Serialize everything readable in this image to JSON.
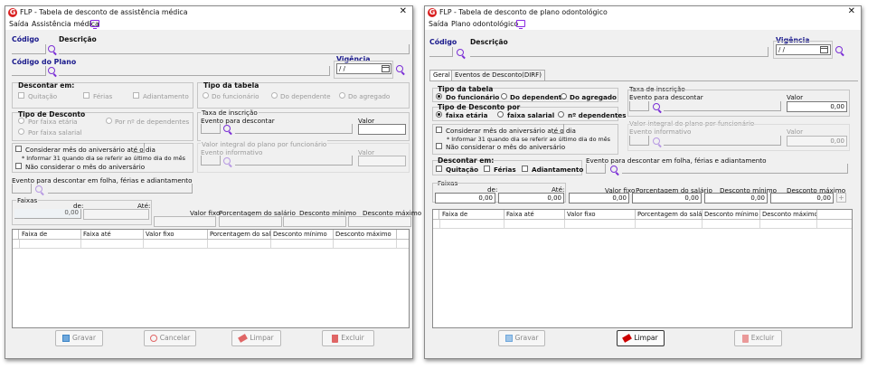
{
  "left": {
    "title": "FLP - Tabela de desconto de assistência médica",
    "close": "✕",
    "menu": {
      "saida": "Saída",
      "item": "Assistência médica"
    },
    "codigo": "Código",
    "descricao": "Descrição",
    "codigo_plano": "Código do Plano",
    "vigencia": "Vigência",
    "vigencia_value": "/ /",
    "descontar_em": "Descontar em:",
    "desc_quitacao": "Quitação",
    "desc_ferias": "Férias",
    "desc_adiantamento": "Adiantamento",
    "tipo_tabela": "Tipo da tabela",
    "tt_funcionario": "Do funcionário",
    "tt_dependente": "Do dependente",
    "tt_agregado": "Do agregado",
    "tipo_desconto": "Tipo de Desconto",
    "td_faixa_etaria": "Por faixa etária",
    "td_n_dependentes": "Por nº de dependentes",
    "td_faixa_salarial": "Por faixa salarial",
    "taxa_inscricao": "Taxa de inscrição",
    "evento_para_descontar": "Evento para descontar",
    "valor": "Valor",
    "considerar_mes": "Considerar mês do aniversário até o dia",
    "informar_31": "* Informar 31 quando dia se referir ao último dia do mês",
    "nao_considerar": "Não considerar o mês do aniversário",
    "valor_integral": "Valor integral do plano por funcionário",
    "evento_informativo": "Evento informativo",
    "evento_folha": "Evento para descontar em folha, férias e adiantamento",
    "faixas": "Faixas",
    "de": "de:",
    "ate": "Até:",
    "de_value": "0,00",
    "valor_fixo": "Valor fixo",
    "porc_salario": "Porcentagem do salário",
    "desc_minimo": "Desconto mínimo",
    "desc_maximo": "Desconto máximo",
    "grid_cols": [
      "Faixa de",
      "Faixa até",
      "Valor fixo",
      "Porcentagem do salário",
      "Desconto mínimo",
      "Desconto máximo"
    ],
    "buttons": {
      "gravar": "Gravar",
      "cancelar": "Cancelar",
      "limpar": "Limpar",
      "excluir": "Excluir"
    }
  },
  "right": {
    "title": "FLP - Tabela de desconto de plano odontológico",
    "close": "✕",
    "menu": {
      "saida": "Saída",
      "item": "Plano odontológico"
    },
    "codigo": "Código",
    "descricao": "Descrição",
    "vigencia": "Vigência",
    "vigencia_value": "/ /",
    "tabs": [
      "Geral",
      "Eventos de Desconto(DIRF)"
    ],
    "tipo_tabela": "Tipo da tabela",
    "tt_funcionario": "Do funcionário",
    "tt_dependente": "Do dependente",
    "tt_agregado": "Do agregado",
    "tipo_desconto": "Tipo de Desconto por",
    "td_faixa_etaria": "faixa etária",
    "td_faixa_salarial": "faixa salarial",
    "td_n_dependentes": "nº dependentes",
    "taxa_inscricao": "Taxa de inscrição",
    "evento_para_descontar": "Evento para descontar",
    "valor": "Valor",
    "taxa_valor": "0,00",
    "considerar_mes": "Considerar mês do aniversário até o dia",
    "informar_31": "* Informar 31 quando dia se referir ao último dia do mês",
    "nao_considerar": "Não considerar o mês do aniversário",
    "valor_integral": "Valor integral do plano por funcionário",
    "evento_informativo": "Evento informativo",
    "integral_valor": "0,00",
    "descontar_em": "Descontar em:",
    "desc_quitacao": "Quitação",
    "desc_ferias": "Férias",
    "desc_adiantamento": "Adiantamento",
    "evento_folha": "Evento para descontar em folha, férias e adiantamento",
    "faixas": "Faixas",
    "de": "de:",
    "ate": "Até:",
    "de_value": "0,00",
    "ate_value": "0,00",
    "valor_fixo": "Valor fixo",
    "porc_salario": "Porcentagem do salário",
    "desc_minimo": "Desconto mínimo",
    "desc_maximo": "Desconto máximo",
    "vf_value": "0,00",
    "ps_value": "0,00",
    "dmin_value": "0,00",
    "dmax_value": "0,00",
    "plus": "+",
    "grid_cols": [
      "Faixa de",
      "Faixa até",
      "Valor fixo",
      "Porcentagem do salário",
      "Desconto mínimo",
      "Desconto máximo"
    ],
    "buttons": {
      "gravar": "Gravar",
      "limpar": "Limpar",
      "excluir": "Excluir"
    }
  },
  "colors": {
    "accent_blue": "#1a1a8c",
    "icon_purple": "#7b2fd6",
    "logo_red": "#d92020"
  },
  "icons": [
    "search-icon",
    "calendar-icon",
    "save-icon",
    "cancel-icon",
    "eraser-icon",
    "trash-icon",
    "monitor-icon"
  ]
}
